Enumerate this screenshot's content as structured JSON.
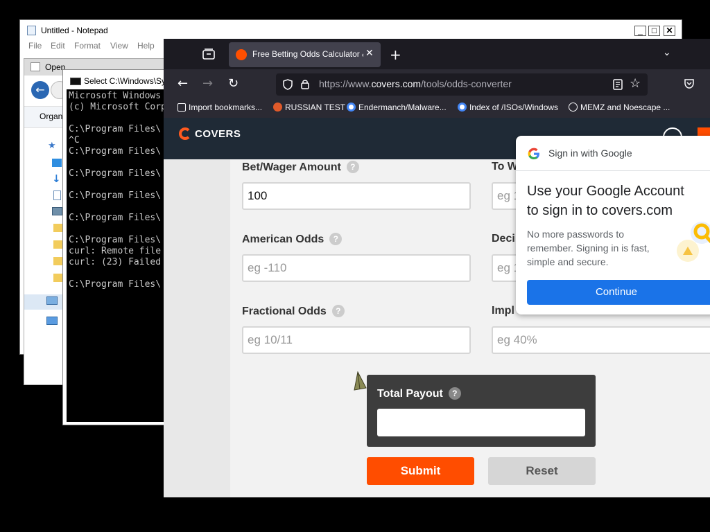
{
  "notepad": {
    "title": "Untitled - Notepad",
    "menu": [
      "File",
      "Edit",
      "Format",
      "View",
      "Help"
    ],
    "minimize": "_",
    "maximize": "□",
    "close": "✕"
  },
  "open_dialog": {
    "title": "Open",
    "organize": "Organ"
  },
  "cmd": {
    "title": "Select C:\\Windows\\Sy",
    "lines": [
      "Microsoft Windows",
      "(c) Microsoft Corp",
      "",
      "C:\\Program Files\\",
      "^C",
      "C:\\Program Files\\",
      "",
      "C:\\Program Files\\",
      "",
      "C:\\Program Files\\",
      "",
      "C:\\Program Files\\",
      "",
      "C:\\Program Files\\",
      "curl: Remote file",
      "curl: (23) Failed",
      "",
      "C:\\Program Files\\"
    ]
  },
  "browser": {
    "tab_title": "Free Betting Odds Calculator &",
    "tab_close": "✕",
    "new_tab": "+",
    "url_prefix": "https://www.",
    "url_domain": "covers.com",
    "url_path": "/tools/odds-converter",
    "bookmarks": [
      {
        "label": "Import bookmarks...",
        "icon": "import-icon",
        "color": "#fbfbfe"
      },
      {
        "label": "RUSSIAN TEST",
        "icon": "headphones-icon",
        "color": "#e05a2a"
      },
      {
        "label": "Endermanch/Malware...",
        "icon": "google-icon",
        "color": "#ffffff"
      },
      {
        "label": "Index of /ISOs/Windows",
        "icon": "google-icon",
        "color": "#ffffff"
      },
      {
        "label": "MEMZ and Noescape ...",
        "icon": "globe-icon",
        "color": "#fbfbfe"
      }
    ]
  },
  "page": {
    "logo": "COVERS",
    "bet_label": "Bet/Wager Amount",
    "bet_value": "100",
    "to_win_label": "To W",
    "to_win_placeholder": "eg 1",
    "american_label": "American Odds",
    "american_placeholder": "eg -110",
    "decimal_label": "Deci",
    "decimal_placeholder": "eg 1",
    "fractional_label": "Fractional Odds",
    "fractional_placeholder": "eg 10/11",
    "implied_label": "Impl",
    "implied_placeholder": "eg 40%",
    "qmark": "?",
    "total_payout_label": "Total Payout",
    "submit": "Submit",
    "reset": "Reset"
  },
  "google_popup": {
    "header": "Sign in with Google",
    "title": "Use your Google Account to sign in to covers.com",
    "description": "No more passwords to remember. Signing in is fast, simple and secure.",
    "continue": "Continue"
  },
  "colors": {
    "accent": "#ff4d00",
    "google_blue": "#1a73e8",
    "page_header": "#1f2a36"
  }
}
